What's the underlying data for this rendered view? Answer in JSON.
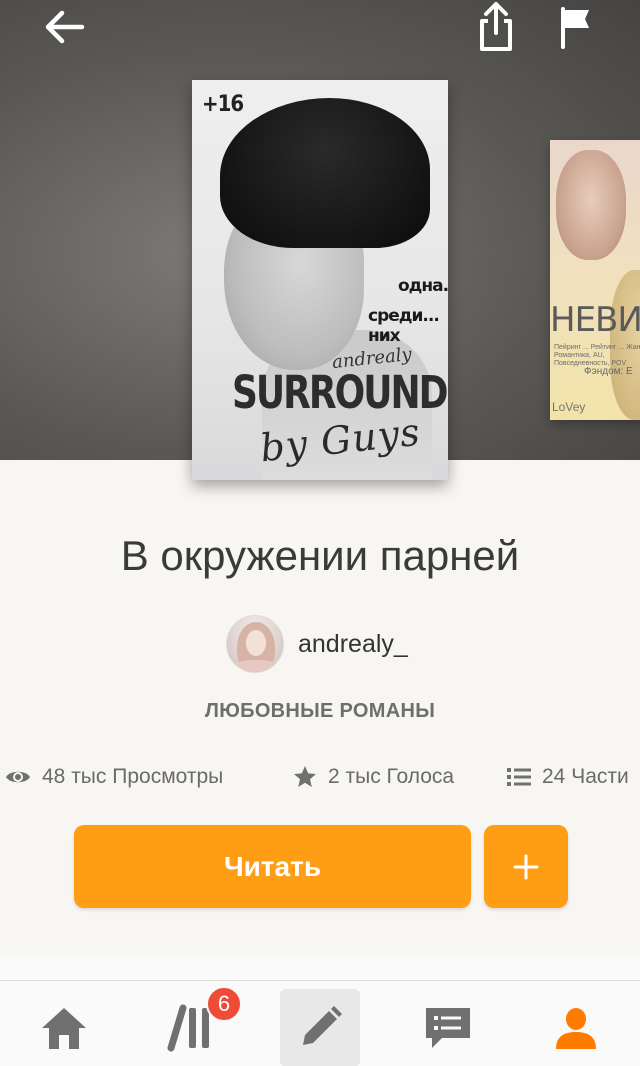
{
  "header": {
    "back_icon": "arrow-left-icon",
    "share_icon": "share-icon",
    "report_icon": "flag-icon"
  },
  "cover": {
    "rating": "+16",
    "line1": "одна...",
    "line2": "среди... них",
    "author_sig": "andrealy",
    "title": "SURROUNDED",
    "subtitle": "by Guys"
  },
  "next_cover": {
    "title": "НЕВИД",
    "small_text": "Пейринг ... Рейтинг ... Жанры: Романтика, AU, Повседневность, POV",
    "fandom": "Фэндом: Е",
    "signature": "LoVey"
  },
  "book": {
    "title": "В окружении парней",
    "author": "andrealy_",
    "category": "ЛЮБОВНЫЕ РОМАНЫ"
  },
  "stats": {
    "views": "48 тыс Просмотры",
    "votes": "2 тыс Голоса",
    "parts": "24 Части"
  },
  "actions": {
    "read_label": "Читать",
    "add_label": "+"
  },
  "tabbar": {
    "badge_count": "6",
    "items": [
      "home-icon",
      "library-icon",
      "write-icon",
      "messages-icon",
      "profile-icon"
    ]
  },
  "colors": {
    "accent": "#ff9e14",
    "badge": "#f04b36",
    "profile_active": "#ff7b00"
  }
}
